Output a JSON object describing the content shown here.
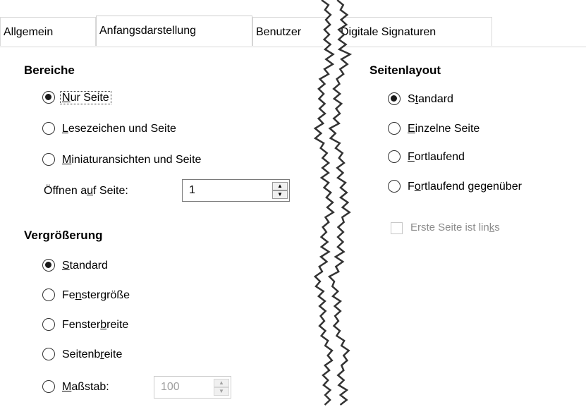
{
  "tabs": {
    "allgemein": "Allgemein",
    "anfangsdarstellung": "Anfangsdarstellung",
    "benutzer": "Benutzer",
    "digitale_signaturen": "Digitale Signaturen"
  },
  "bereiche": {
    "title": "Bereiche",
    "options": [
      {
        "pre": "",
        "key": "N",
        "post": "ur Seite",
        "checked": true
      },
      {
        "pre": "",
        "key": "L",
        "post": "esezeichen und Seite",
        "checked": false
      },
      {
        "pre": "",
        "key": "M",
        "post": "iniaturansichten und Seite",
        "checked": false
      }
    ],
    "open_on_page": {
      "pre": "Öffnen a",
      "key": "u",
      "post": "f Seite:",
      "value": "1"
    }
  },
  "vergroesserung": {
    "title": "Vergrößerung",
    "options": [
      {
        "pre": "",
        "key": "S",
        "post": "tandard",
        "checked": true
      },
      {
        "pre": "Fe",
        "key": "n",
        "post": "stergröße",
        "checked": false
      },
      {
        "pre": "Fenster",
        "key": "b",
        "post": "reite",
        "checked": false
      },
      {
        "pre": "Seitenb",
        "key": "r",
        "post": "eite",
        "checked": false
      }
    ],
    "massstab": {
      "pre": "",
      "key": "M",
      "post": "aßstab:",
      "value": "100",
      "checked": false
    }
  },
  "seitenlayout": {
    "title": "Seitenlayout",
    "options": [
      {
        "pre": "S",
        "key": "t",
        "post": "andard",
        "checked": true
      },
      {
        "pre": "",
        "key": "E",
        "post": "inzelne Seite",
        "checked": false
      },
      {
        "pre": "",
        "key": "F",
        "post": "ortlaufend",
        "checked": false
      },
      {
        "pre": "F",
        "key": "o",
        "post": "rtlaufend gegenüber",
        "checked": false
      }
    ],
    "erste_seite": {
      "pre": "Erste Seite ist lin",
      "key": "k",
      "post": "s",
      "checked": false
    }
  }
}
